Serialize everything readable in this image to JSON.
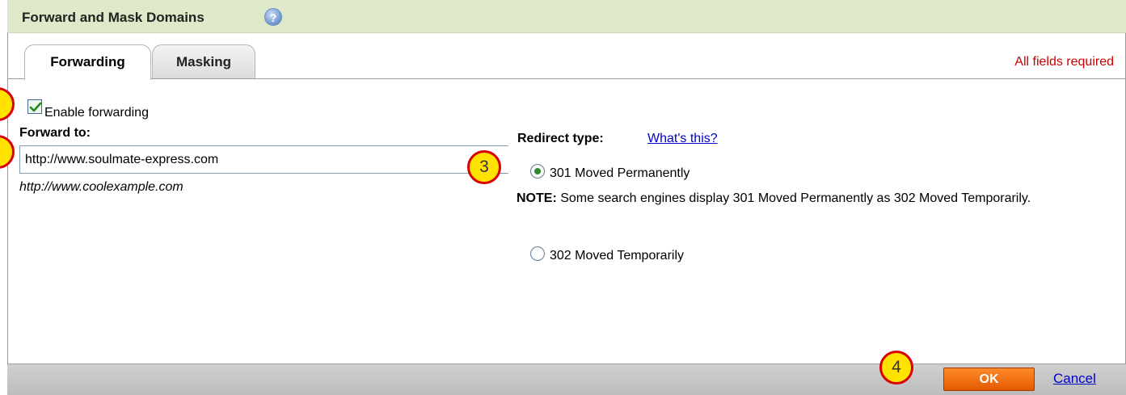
{
  "dialog": {
    "title": "Forward and Mask Domains",
    "required_note": "All fields required"
  },
  "tabs": [
    {
      "label": "Forwarding",
      "active": true
    },
    {
      "label": "Masking",
      "active": false
    }
  ],
  "forwarding": {
    "enable_label": "Enable forwarding",
    "enabled": true,
    "forward_to_label": "Forward to:",
    "forward_to_value": "http://www.soulmate-express.com",
    "example_hint": "http://www.coolexample.com"
  },
  "redirect": {
    "label": "Redirect type:",
    "help_link": "What's this?",
    "options": [
      {
        "label": "301 Moved Permanently",
        "selected": true
      },
      {
        "label": "302 Moved Temporarily",
        "selected": false
      }
    ],
    "note_prefix": "NOTE:",
    "note_text": " Some search engines display 301 Moved Permanently as 302 Moved Temporarily."
  },
  "callouts": [
    "3",
    "4"
  ],
  "footer": {
    "ok_label": "OK",
    "cancel_label": "Cancel"
  },
  "colors": {
    "header_bg": "#dde9c8",
    "required_text": "#cc0000",
    "ok_button": "#f26b0f",
    "callout_fill": "#ffe200",
    "callout_border": "#d80000"
  }
}
